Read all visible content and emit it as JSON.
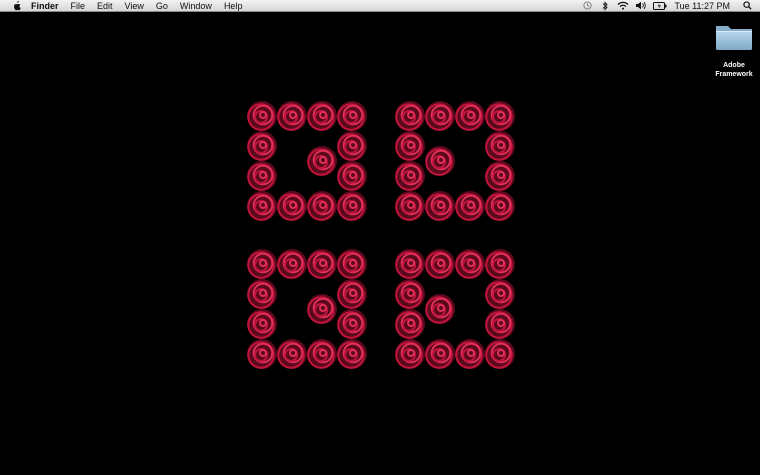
{
  "menubar": {
    "apple_icon": "apple-logo-icon",
    "app_name": "Finder",
    "items": [
      "File",
      "Edit",
      "View",
      "Go",
      "Window",
      "Help"
    ],
    "status_icons": [
      "time-machine-icon",
      "bluetooth-icon",
      "wifi-icon",
      "volume-icon",
      "battery-icon"
    ],
    "clock": "Tue 11:27 PM",
    "spotlight_icon": "spotlight-search-icon"
  },
  "desktop": {
    "folder": {
      "icon": "folder-icon",
      "label_line1": "Adobe",
      "label_line2": "Framework"
    },
    "wallpaper": {
      "description_icon": "rose-logo-wallpaper",
      "accent_color": "#c0143c",
      "background_color": "#000000"
    }
  }
}
